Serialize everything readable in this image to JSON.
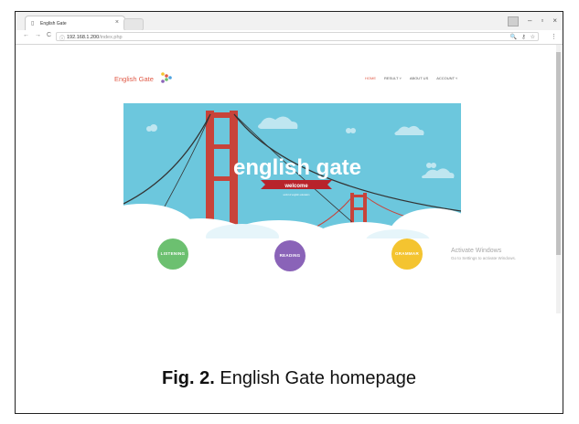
{
  "browser": {
    "tab_title": "English Gate",
    "url_host": "192.168.1.200",
    "url_path": "/index.php"
  },
  "site": {
    "logo_text": "English Gate",
    "nav": [
      "HOME",
      "RESULT ˅",
      "ABOUT US",
      "ACCOUNT ˅"
    ],
    "hero_title": "english gate",
    "hero_ribbon": "welcome",
    "hero_small": "world of english education",
    "categories": [
      {
        "label": "LISTENING",
        "color": "#6cc070"
      },
      {
        "label": "READING",
        "color": "#8a63b8"
      },
      {
        "label": "GRAMMAR",
        "color": "#f4c430"
      }
    ]
  },
  "os_watermark": {
    "line1": "Activate Windows",
    "line2": "Go to Settings to activate Windows."
  },
  "caption": {
    "label": "Fig. 2.",
    "text": "English Gate homepage"
  },
  "colors": {
    "brand_red": "#e05a47",
    "sky": "#6cc7dd",
    "bridge": "#c8433a"
  }
}
